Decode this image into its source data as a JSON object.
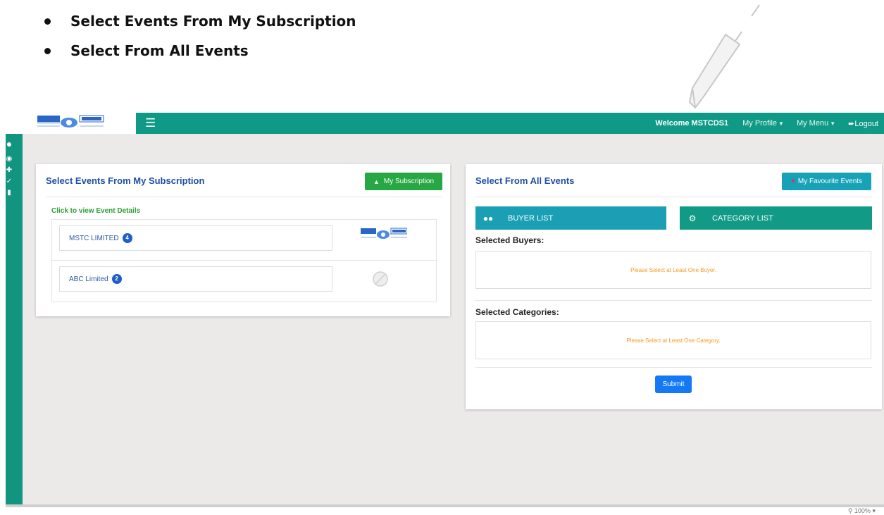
{
  "doc": {
    "bullets": [
      "Select Events From My Subscription",
      "Select From All Events"
    ]
  },
  "topbar": {
    "menu_icon": "hamburger-icon",
    "welcome": "Welcome MSTCDS1",
    "my_profile": "My Profile",
    "my_menu": "My Menu",
    "logout": "Logout"
  },
  "subscription_card": {
    "title": "Select Events From My Subscription",
    "button": "My Subscription",
    "click_label": "Click to view Event Details",
    "rows": [
      {
        "name": "MSTC LIMITED",
        "count": "4"
      },
      {
        "name": "ABC Limited",
        "count": "2"
      }
    ]
  },
  "all_events_card": {
    "title": "Select From All Events",
    "favourite_button": "My Favourite Events",
    "buyer_list": "BUYER LIST",
    "category_list": "CATEGORY LIST",
    "selected_buyers_label": "Selected Buyers:",
    "buyers_placeholder": "Please Select at Least One Buyer.",
    "selected_categories_label": "Selected Categories:",
    "categories_placeholder": "Please Select at Least One Category.",
    "submit": "Submit"
  },
  "statusbar": {
    "zoom": "100%"
  },
  "colors": {
    "topbar": "#0e9a86",
    "title": "#1e4fa6",
    "green_button": "#27a844",
    "teal_button": "#17a2b8",
    "warning_text": "#f39a1e",
    "submit": "#1479f5"
  }
}
